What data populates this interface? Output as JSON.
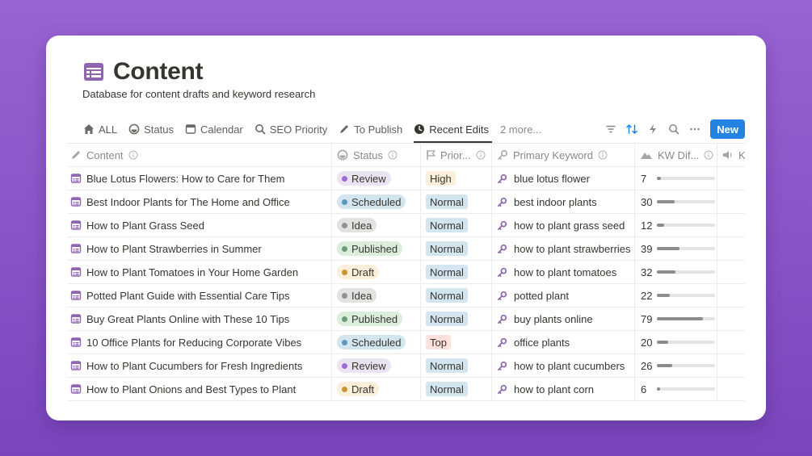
{
  "page": {
    "title": "Content",
    "subtitle": "Database for content drafts and keyword research"
  },
  "tabs": [
    {
      "label": "ALL",
      "icon": "home-icon"
    },
    {
      "label": "Status",
      "icon": "status-icon"
    },
    {
      "label": "Calendar",
      "icon": "calendar-icon"
    },
    {
      "label": "SEO Priority",
      "icon": "search-icon"
    },
    {
      "label": "To Publish",
      "icon": "pencil-icon"
    },
    {
      "label": "Recent Edits",
      "icon": "clock-icon",
      "active": true
    }
  ],
  "more_tabs_label": "2 more...",
  "new_button_label": "New",
  "columns": {
    "content": "Content",
    "status": "Status",
    "priority": "Prior...",
    "keyword": "Primary Keyword",
    "kw_difficulty": "KW Dif...",
    "extra": "K"
  },
  "colors": {
    "accent": "#2383e2",
    "background": "#8a55c8",
    "status": {
      "Review": {
        "bg": "#eae4f2",
        "dot": "#9a6dd7"
      },
      "Scheduled": {
        "bg": "#d3e5ef",
        "dot": "#5b97bd"
      },
      "Idea": {
        "bg": "#e3e2e0",
        "dot": "#91918e"
      },
      "Published": {
        "bg": "#dbeddb",
        "dot": "#6c9b7d"
      },
      "Draft": {
        "bg": "#fbeeda",
        "dot": "#cb9433"
      }
    },
    "priority": {
      "High": "#fbeeda",
      "Normal": "#d3e5ef",
      "Top": "#ffe2dd"
    }
  },
  "rows": [
    {
      "content": "Blue Lotus Flowers: How to Care for Them",
      "status": "Review",
      "priority": "High",
      "keyword": "blue lotus flower",
      "kd": 7
    },
    {
      "content": "Best Indoor Plants for The Home and Office",
      "status": "Scheduled",
      "priority": "Normal",
      "keyword": "best indoor plants",
      "kd": 30
    },
    {
      "content": "How to Plant Grass Seed",
      "status": "Idea",
      "priority": "Normal",
      "keyword": "how to plant grass seed",
      "kd": 12
    },
    {
      "content": "How to Plant Strawberries in Summer",
      "status": "Published",
      "priority": "Normal",
      "keyword": "how to plant strawberries",
      "kd": 39
    },
    {
      "content": "How to Plant Tomatoes in Your Home Garden",
      "status": "Draft",
      "priority": "Normal",
      "keyword": "how to plant tomatoes",
      "kd": 32
    },
    {
      "content": "Potted Plant Guide with Essential Care Tips",
      "status": "Idea",
      "priority": "Normal",
      "keyword": "potted plant",
      "kd": 22
    },
    {
      "content": "Buy Great Plants Online with These 10 Tips",
      "status": "Published",
      "priority": "Normal",
      "keyword": "buy plants online",
      "kd": 79
    },
    {
      "content": "10 Office Plants for Reducing Corporate Vibes",
      "status": "Scheduled",
      "priority": "Top",
      "keyword": "office plants",
      "kd": 20
    },
    {
      "content": "How to Plant Cucumbers for Fresh Ingredients",
      "status": "Review",
      "priority": "Normal",
      "keyword": "how to plant cucumbers",
      "kd": 26
    },
    {
      "content": "How to Plant Onions and Best Types to Plant",
      "status": "Draft",
      "priority": "Normal",
      "keyword": "how to plant corn",
      "kd": 6
    }
  ]
}
